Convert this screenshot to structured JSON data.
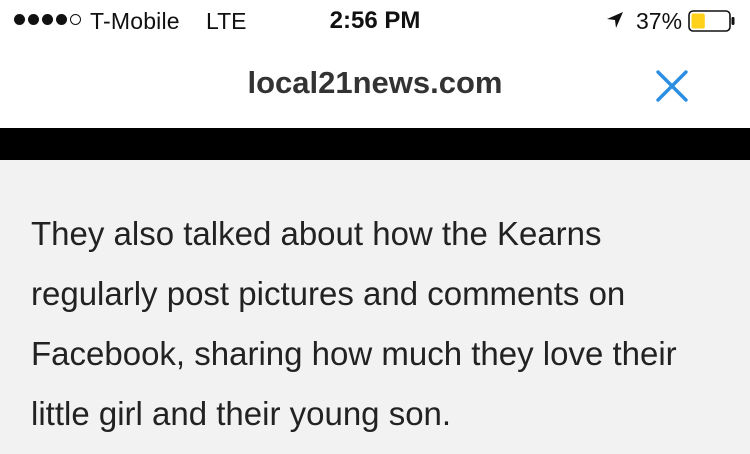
{
  "status_bar": {
    "signal_strength": 4,
    "signal_max": 5,
    "carrier": "T-Mobile",
    "network": "LTE",
    "time": "2:56 PM",
    "location_icon": "location-arrow-icon",
    "battery_percent": "37%",
    "battery_level": 0.37,
    "battery_color": "#ffd11a"
  },
  "address_bar": {
    "domain": "local21news.com",
    "close_icon": "close-icon",
    "close_color": "#2b8ee3"
  },
  "article": {
    "text": "They also talked about how the Kearns\nregularly post pictures and comments on\nFacebook, sharing how much they love their\nlittle girl and their young son."
  }
}
